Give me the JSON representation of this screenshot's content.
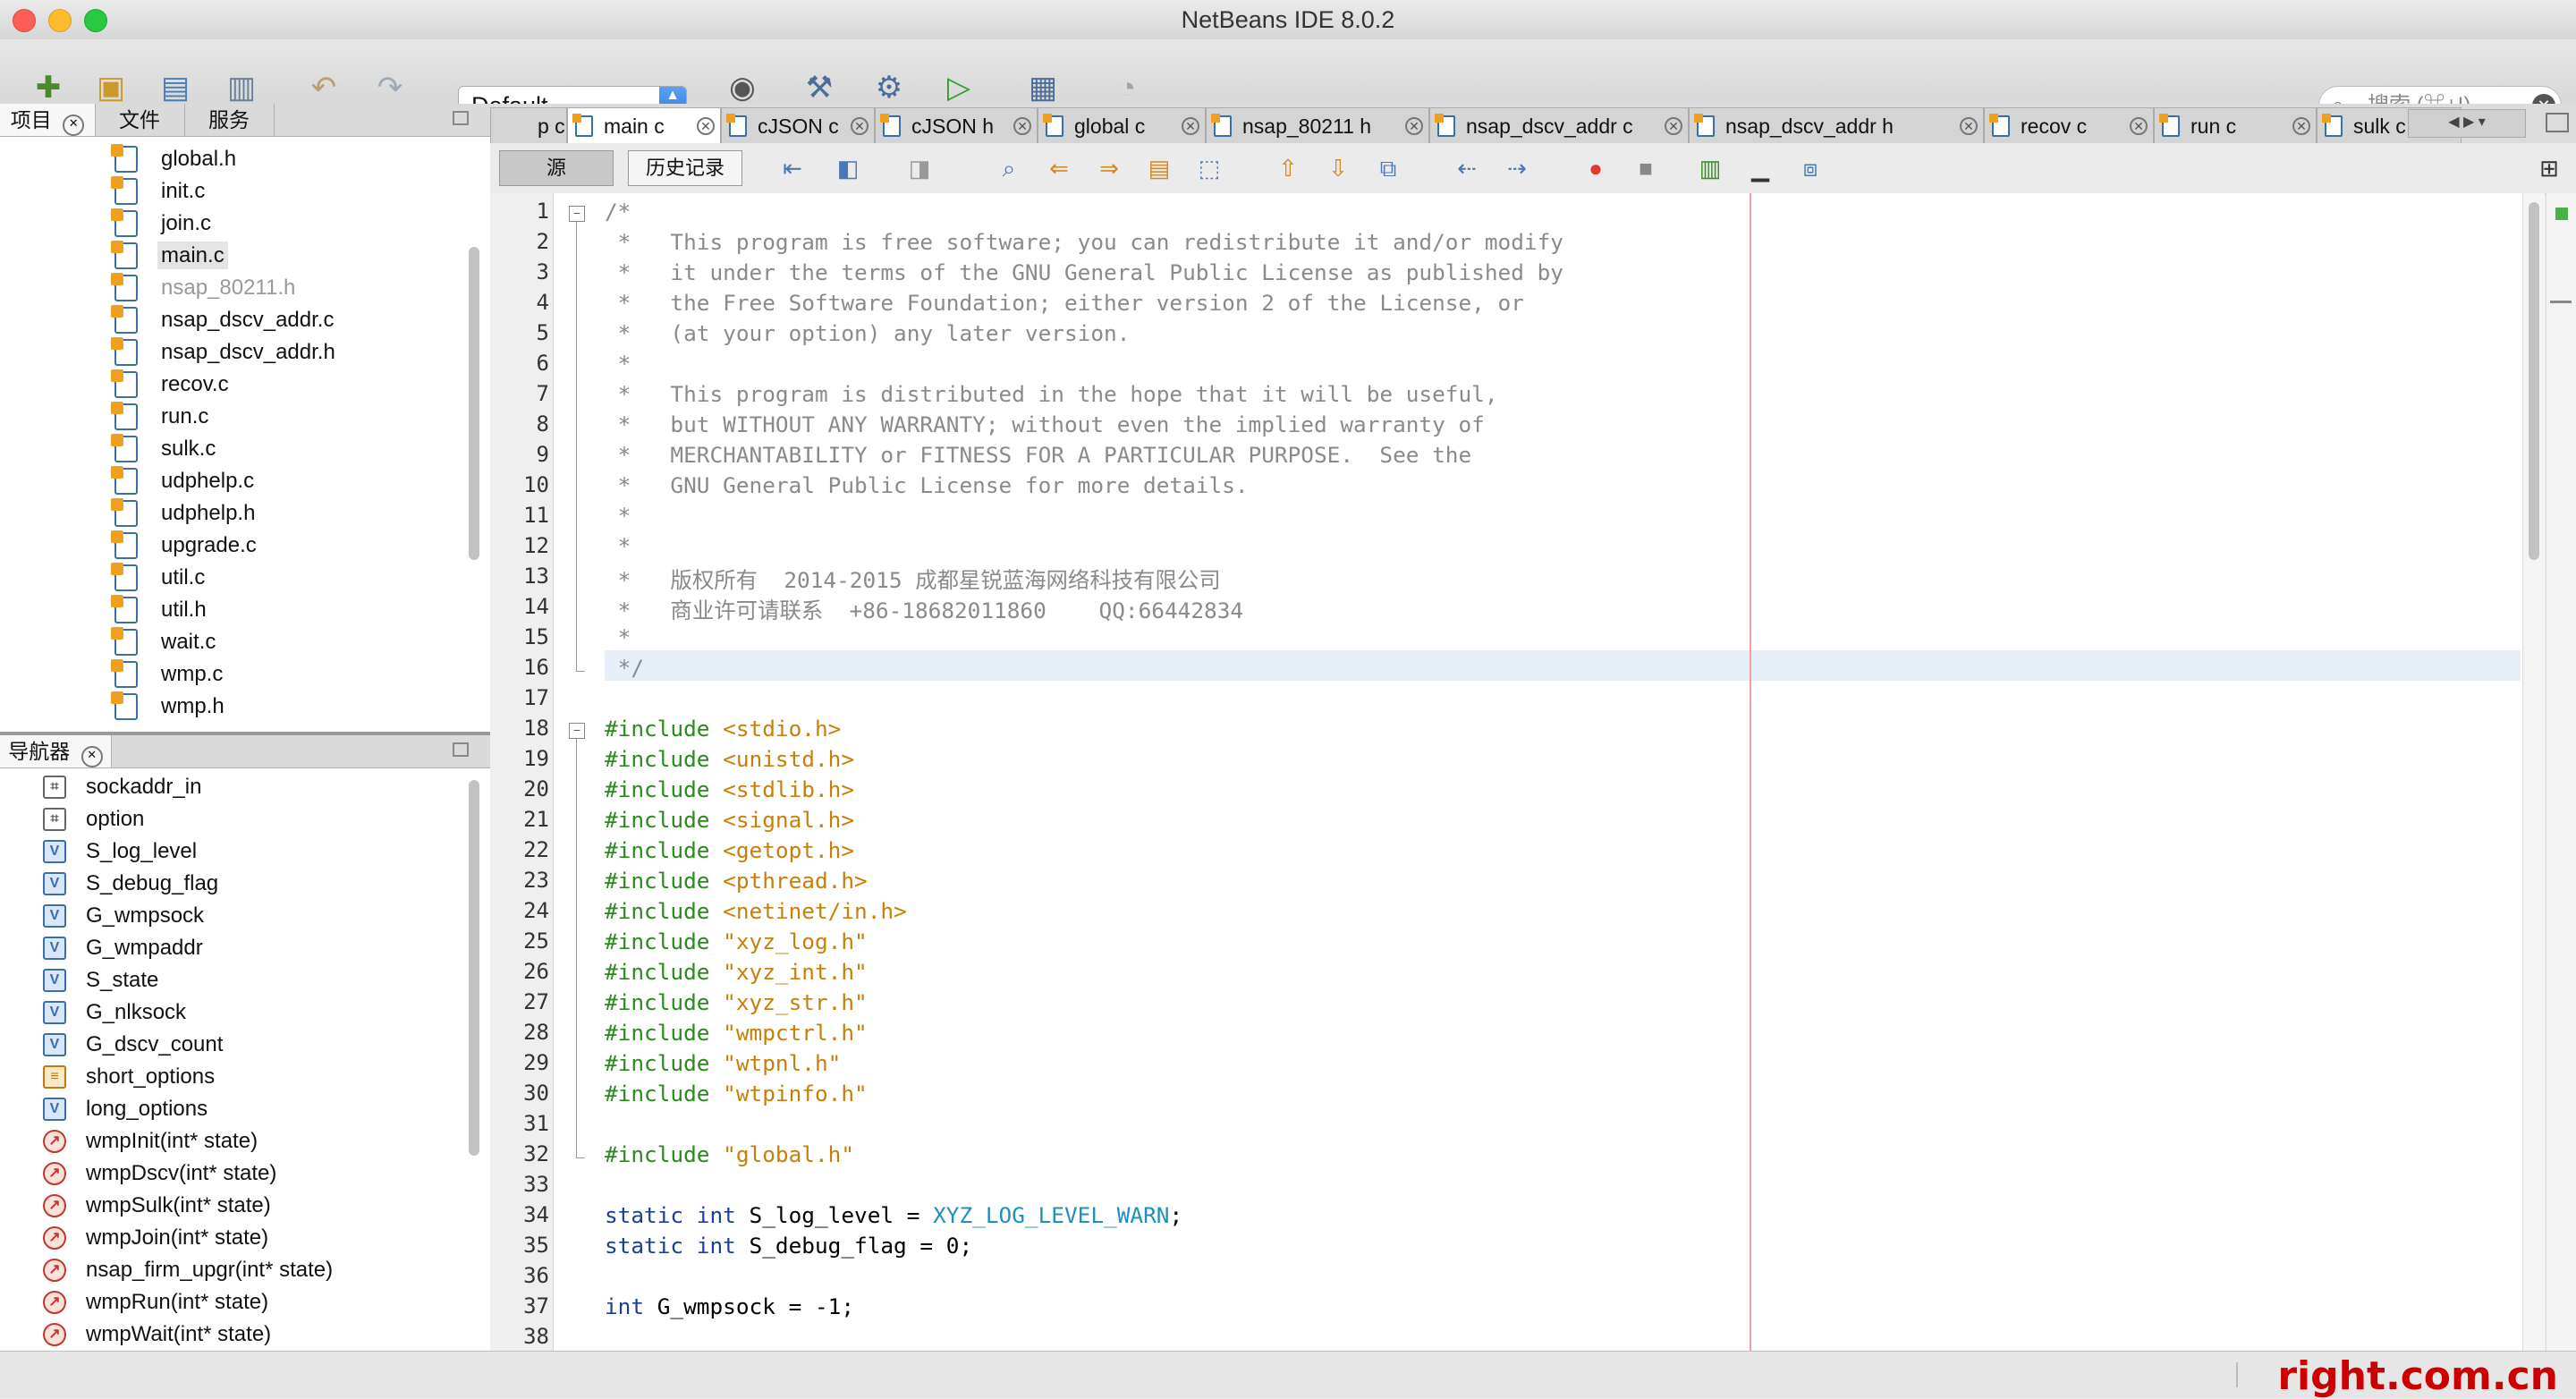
{
  "window": {
    "title": "NetBeans IDE 8.0.2"
  },
  "toolbar": {
    "config_value": "Default",
    "search_placeholder": "搜索 (⌘+I)"
  },
  "projects_panel": {
    "tabs": [
      "项目",
      "文件",
      "服务"
    ],
    "files": [
      {
        "name": "global.h",
        "dim": false
      },
      {
        "name": "init.c",
        "dim": false
      },
      {
        "name": "join.c",
        "dim": false
      },
      {
        "name": "main.c",
        "dim": false,
        "selected": true
      },
      {
        "name": "nsap_80211.h",
        "dim": true
      },
      {
        "name": "nsap_dscv_addr.c",
        "dim": false
      },
      {
        "name": "nsap_dscv_addr.h",
        "dim": false
      },
      {
        "name": "recov.c",
        "dim": false
      },
      {
        "name": "run.c",
        "dim": false
      },
      {
        "name": "sulk.c",
        "dim": false
      },
      {
        "name": "udphelp.c",
        "dim": false
      },
      {
        "name": "udphelp.h",
        "dim": false
      },
      {
        "name": "upgrade.c",
        "dim": false
      },
      {
        "name": "util.c",
        "dim": false
      },
      {
        "name": "util.h",
        "dim": false
      },
      {
        "name": "wait.c",
        "dim": false
      },
      {
        "name": "wmp.c",
        "dim": false
      },
      {
        "name": "wmp.h",
        "dim": false
      }
    ]
  },
  "navigator_panel": {
    "title": "导航器",
    "items": [
      {
        "label": "sockaddr_in",
        "kind": "struct"
      },
      {
        "label": "option",
        "kind": "struct"
      },
      {
        "label": "S_log_level",
        "kind": "field"
      },
      {
        "label": "S_debug_flag",
        "kind": "field"
      },
      {
        "label": "G_wmpsock",
        "kind": "field"
      },
      {
        "label": "G_wmpaddr",
        "kind": "field"
      },
      {
        "label": "S_state",
        "kind": "field"
      },
      {
        "label": "G_nlksock",
        "kind": "field"
      },
      {
        "label": "G_dscv_count",
        "kind": "field"
      },
      {
        "label": "short_options",
        "kind": "var"
      },
      {
        "label": "long_options",
        "kind": "field"
      },
      {
        "label": "wmpInit(int* state)",
        "kind": "method"
      },
      {
        "label": "wmpDscv(int* state)",
        "kind": "method"
      },
      {
        "label": "wmpSulk(int* state)",
        "kind": "method"
      },
      {
        "label": "wmpJoin(int* state)",
        "kind": "method"
      },
      {
        "label": "nsap_firm_upgr(int* state)",
        "kind": "method"
      },
      {
        "label": "wmpRun(int* state)",
        "kind": "method"
      },
      {
        "label": "wmpWait(int* state)",
        "kind": "method"
      }
    ]
  },
  "editor": {
    "tabs": [
      "p c",
      "main c",
      "cJSON c",
      "cJSON h",
      "global c",
      "nsap_80211 h",
      "nsap_dscv_addr c",
      "nsap_dscv_addr h",
      "recov c",
      "run c",
      "sulk c"
    ],
    "active_tab": "main c",
    "view_tabs": [
      "源",
      "历史记录"
    ],
    "lines": [
      {
        "n": "1",
        "segs": [
          {
            "t": "/*",
            "c": "cm"
          }
        ]
      },
      {
        "n": "2",
        "segs": [
          {
            "t": " *   This program is free software; you can redistribute it and/or modify",
            "c": "cm"
          }
        ]
      },
      {
        "n": "3",
        "segs": [
          {
            "t": " *   it under the terms of the GNU General Public License as published by",
            "c": "cm"
          }
        ]
      },
      {
        "n": "4",
        "segs": [
          {
            "t": " *   the Free Software Foundation; either version 2 of the License, or",
            "c": "cm"
          }
        ]
      },
      {
        "n": "5",
        "segs": [
          {
            "t": " *   (at your option) any later version.",
            "c": "cm"
          }
        ]
      },
      {
        "n": "6",
        "segs": [
          {
            "t": " *",
            "c": "cm"
          }
        ]
      },
      {
        "n": "7",
        "segs": [
          {
            "t": " *   This program is distributed in the hope that it will be useful,",
            "c": "cm"
          }
        ]
      },
      {
        "n": "8",
        "segs": [
          {
            "t": " *   but WITHOUT ANY WARRANTY; without even the implied warranty of",
            "c": "cm"
          }
        ]
      },
      {
        "n": "9",
        "segs": [
          {
            "t": " *   MERCHANTABILITY or FITNESS FOR A PARTICULAR PURPOSE.  See the",
            "c": "cm"
          }
        ]
      },
      {
        "n": "10",
        "segs": [
          {
            "t": " *   GNU General Public License for more details.",
            "c": "cm"
          }
        ]
      },
      {
        "n": "11",
        "segs": [
          {
            "t": " *",
            "c": "cm"
          }
        ]
      },
      {
        "n": "12",
        "segs": [
          {
            "t": " *",
            "c": "cm"
          }
        ]
      },
      {
        "n": "13",
        "segs": [
          {
            "t": " *   版权所有  2014-2015 成都星锐蓝海网络科技有限公司",
            "c": "cm"
          }
        ]
      },
      {
        "n": "14",
        "segs": [
          {
            "t": " *   商业许可请联系  +86-18682011860    QQ:66442834",
            "c": "cm"
          }
        ]
      },
      {
        "n": "15",
        "segs": [
          {
            "t": " *",
            "c": "cm"
          }
        ]
      },
      {
        "n": "16",
        "segs": [
          {
            "t": " */",
            "c": "cm"
          }
        ]
      },
      {
        "n": "17",
        "segs": []
      },
      {
        "n": "18",
        "segs": [
          {
            "t": "#include ",
            "c": "pp"
          },
          {
            "t": "<stdio.h>",
            "c": "str"
          }
        ]
      },
      {
        "n": "19",
        "segs": [
          {
            "t": "#include ",
            "c": "pp"
          },
          {
            "t": "<unistd.h>",
            "c": "str"
          }
        ]
      },
      {
        "n": "20",
        "segs": [
          {
            "t": "#include ",
            "c": "pp"
          },
          {
            "t": "<stdlib.h>",
            "c": "str"
          }
        ]
      },
      {
        "n": "21",
        "segs": [
          {
            "t": "#include ",
            "c": "pp"
          },
          {
            "t": "<signal.h>",
            "c": "str"
          }
        ]
      },
      {
        "n": "22",
        "segs": [
          {
            "t": "#include ",
            "c": "pp"
          },
          {
            "t": "<getopt.h>",
            "c": "str"
          }
        ]
      },
      {
        "n": "23",
        "segs": [
          {
            "t": "#include ",
            "c": "pp"
          },
          {
            "t": "<pthread.h>",
            "c": "str"
          }
        ]
      },
      {
        "n": "24",
        "segs": [
          {
            "t": "#include ",
            "c": "pp"
          },
          {
            "t": "<netinet/in.h>",
            "c": "str"
          }
        ]
      },
      {
        "n": "25",
        "segs": [
          {
            "t": "#include ",
            "c": "pp"
          },
          {
            "t": "\"xyz_log.h\"",
            "c": "str"
          }
        ]
      },
      {
        "n": "26",
        "segs": [
          {
            "t": "#include ",
            "c": "pp"
          },
          {
            "t": "\"xyz_int.h\"",
            "c": "str"
          }
        ]
      },
      {
        "n": "27",
        "segs": [
          {
            "t": "#include ",
            "c": "pp"
          },
          {
            "t": "\"xyz_str.h\"",
            "c": "str"
          }
        ]
      },
      {
        "n": "28",
        "segs": [
          {
            "t": "#include ",
            "c": "pp"
          },
          {
            "t": "\"wmpctrl.h\"",
            "c": "str"
          }
        ]
      },
      {
        "n": "29",
        "segs": [
          {
            "t": "#include ",
            "c": "pp"
          },
          {
            "t": "\"wtpnl.h\"",
            "c": "str"
          }
        ]
      },
      {
        "n": "30",
        "segs": [
          {
            "t": "#include ",
            "c": "pp"
          },
          {
            "t": "\"wtpinfo.h\"",
            "c": "str"
          }
        ]
      },
      {
        "n": "31",
        "segs": []
      },
      {
        "n": "32",
        "segs": [
          {
            "t": "#include ",
            "c": "pp"
          },
          {
            "t": "\"global.h\"",
            "c": "str"
          }
        ]
      },
      {
        "n": "33",
        "segs": []
      },
      {
        "n": "34",
        "segs": [
          {
            "t": "static int ",
            "c": "kw"
          },
          {
            "t": "S_log_level = ",
            "c": ""
          },
          {
            "t": "XYZ_LOG_LEVEL_WARN",
            "c": "mac"
          },
          {
            "t": ";",
            "c": ""
          }
        ]
      },
      {
        "n": "35",
        "segs": [
          {
            "t": "static int ",
            "c": "kw"
          },
          {
            "t": "S_debug_flag = 0;",
            "c": ""
          }
        ]
      },
      {
        "n": "36",
        "segs": []
      },
      {
        "n": "37",
        "segs": [
          {
            "t": "int ",
            "c": "kw"
          },
          {
            "t": "G_wmpsock = -1;",
            "c": ""
          }
        ]
      },
      {
        "n": "38",
        "segs": []
      }
    ]
  },
  "watermark": "right.com.cn",
  "colors": {
    "accent": "#2d72d6",
    "margin_line": "#f0a0a0",
    "current_line": "#e6eef8"
  }
}
